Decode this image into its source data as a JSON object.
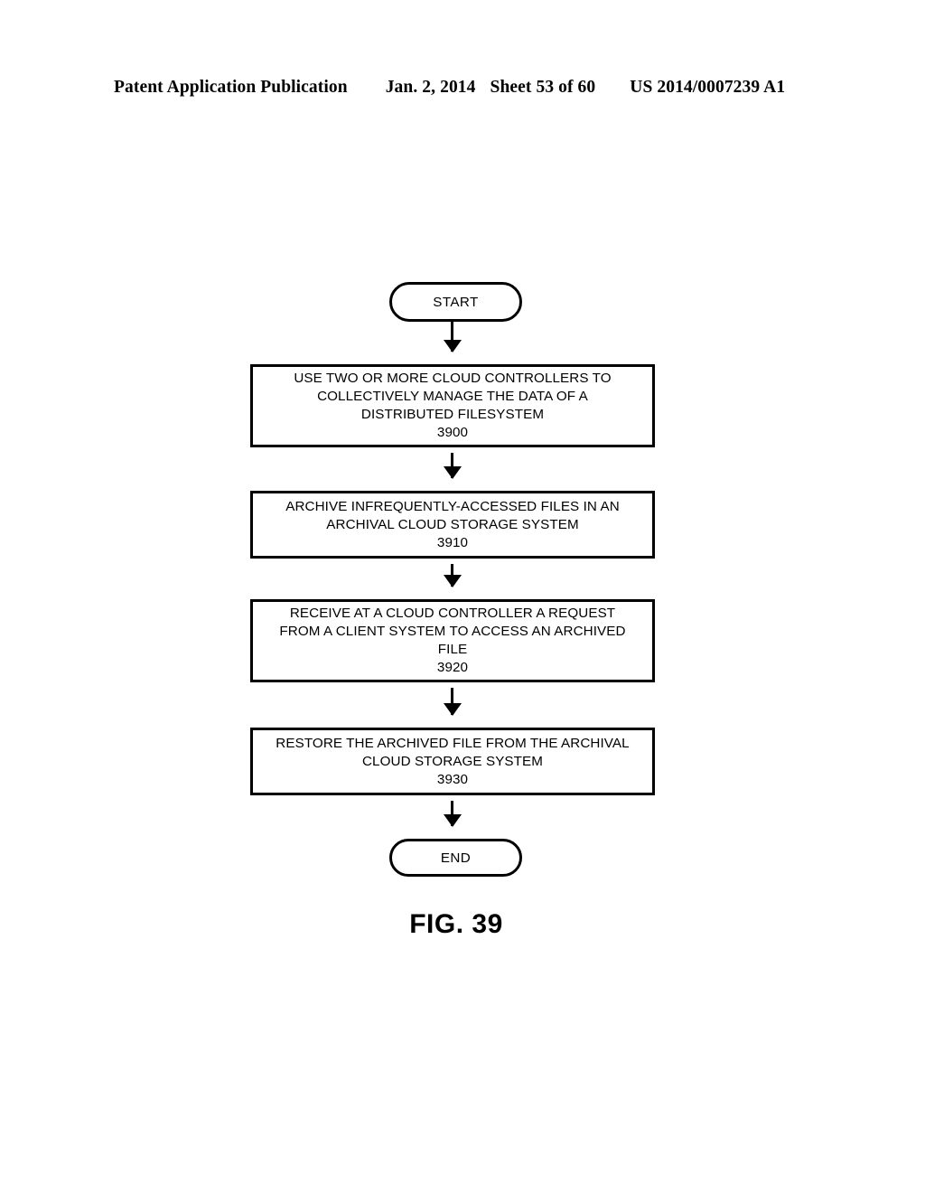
{
  "header": {
    "publication": "Patent Application Publication",
    "date": "Jan. 2, 2014",
    "sheet": "Sheet 53 of 60",
    "patent_number": "US 2014/0007239 A1"
  },
  "figure": {
    "caption": "FIG. 39",
    "type": "flowchart",
    "orientation": "top-to-bottom"
  },
  "flowchart": {
    "start": {
      "label": "START",
      "shape": "terminator"
    },
    "end": {
      "label": "END",
      "shape": "terminator"
    },
    "steps": [
      {
        "ref": "3900",
        "shape": "process",
        "lines": [
          "USE TWO OR MORE CLOUD CONTROLLERS TO",
          "COLLECTIVELY MANAGE THE DATA OF A",
          "DISTRIBUTED FILESYSTEM"
        ]
      },
      {
        "ref": "3910",
        "shape": "process",
        "lines": [
          "ARCHIVE INFREQUENTLY-ACCESSED FILES IN AN",
          "ARCHIVAL CLOUD STORAGE SYSTEM"
        ]
      },
      {
        "ref": "3920",
        "shape": "process",
        "lines": [
          "RECEIVE AT A CLOUD CONTROLLER A REQUEST",
          "FROM A CLIENT SYSTEM TO ACCESS AN ARCHIVED",
          "FILE"
        ]
      },
      {
        "ref": "3930",
        "shape": "process",
        "lines": [
          "RESTORE THE ARCHIVED FILE FROM THE ARCHIVAL",
          "CLOUD STORAGE SYSTEM"
        ]
      }
    ],
    "connectors": [
      {
        "from": "START",
        "to": "3900",
        "arrow": "down"
      },
      {
        "from": "3900",
        "to": "3910",
        "arrow": "down"
      },
      {
        "from": "3910",
        "to": "3920",
        "arrow": "down"
      },
      {
        "from": "3920",
        "to": "3930",
        "arrow": "down"
      },
      {
        "from": "3930",
        "to": "END",
        "arrow": "down"
      }
    ]
  },
  "colors": {
    "ink": "#000000",
    "page": "#ffffff"
  }
}
